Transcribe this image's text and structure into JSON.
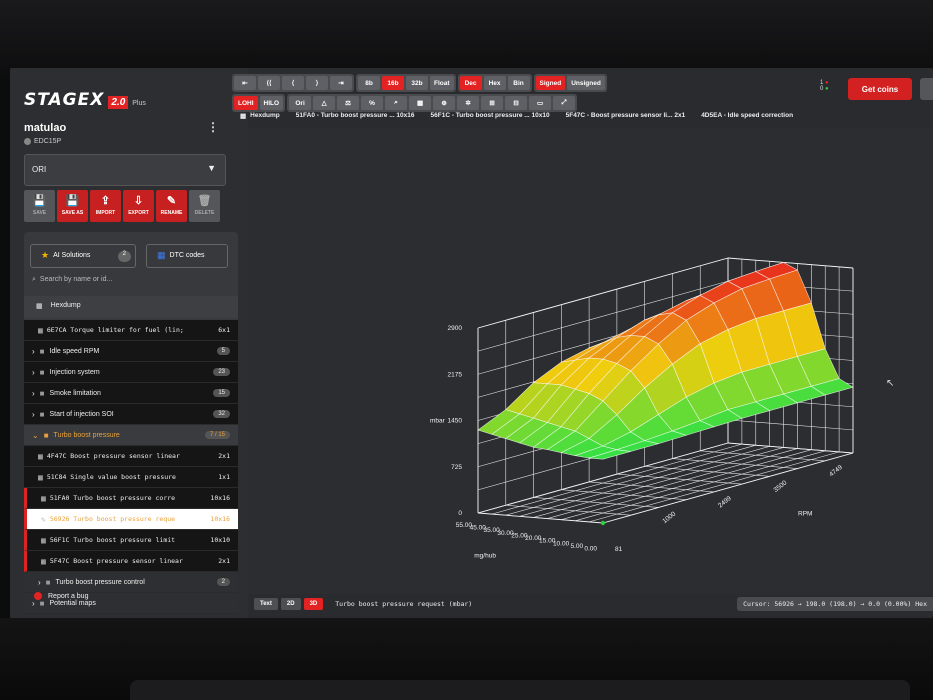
{
  "app": {
    "logo": "STAGEX",
    "version": "2.0",
    "edition": "Plus",
    "user": "matulao",
    "ecu": "EDC15P",
    "selected_file": "ORI"
  },
  "actions": [
    {
      "label": "SAVE",
      "icon": "💾",
      "enabled": false
    },
    {
      "label": "SAVE AS",
      "icon": "💾",
      "enabled": true
    },
    {
      "label": "IMPORT",
      "icon": "⇪",
      "enabled": true
    },
    {
      "label": "EXPORT",
      "icon": "⇩",
      "enabled": true
    },
    {
      "label": "RENAME",
      "icon": "✎",
      "enabled": true
    },
    {
      "label": "DELETE",
      "icon": "🗑",
      "enabled": false
    }
  ],
  "sidebar": {
    "ai_label": "AI Solutions",
    "ai_count": "2",
    "dtc_label": "DTC codes",
    "search_placeholder": "Search by name or id...",
    "hexdump_label": "Hexdump",
    "items": [
      {
        "kind": "map",
        "label": "6E7CA Torque limiter for fuel (lin;",
        "size": "6x1"
      },
      {
        "kind": "folder",
        "label": "Idle speed RPM",
        "count": "5"
      },
      {
        "kind": "folder",
        "label": "Injection system",
        "count": "23"
      },
      {
        "kind": "folder",
        "label": "Smoke limitation",
        "count": "15"
      },
      {
        "kind": "folder",
        "label": "Start of injection SOI",
        "count": "32"
      },
      {
        "kind": "folder-open",
        "label": "Turbo boost pressure",
        "count": "7 / 15"
      },
      {
        "kind": "map",
        "label": "4F47C Boost pressure sensor linear",
        "size": "2x1"
      },
      {
        "kind": "map",
        "label": "51C84 Single value boost pressure",
        "size": "1x1"
      },
      {
        "kind": "map",
        "label": "51FA0 Turbo boost pressure corre",
        "size": "10x16"
      },
      {
        "kind": "map-selected",
        "label": "56926 Turbo boost pressure reque",
        "size": "10x16"
      },
      {
        "kind": "map",
        "label": "56F1C Turbo boost pressure limit",
        "size": "10x10"
      },
      {
        "kind": "map",
        "label": "5F47C Boost pressure sensor linear",
        "size": "2x1"
      },
      {
        "kind": "subfolder",
        "label": "Turbo boost pressure control",
        "count": "2"
      },
      {
        "kind": "folder-plain",
        "label": "Potential maps",
        "count": ""
      }
    ],
    "report_label": "Report a bug"
  },
  "toolbar": {
    "row1_nav": [
      "⇤",
      "⟨⟨",
      "⟨",
      "⟩",
      "⇥"
    ],
    "row1_width": [
      {
        "label": "8b",
        "on": false
      },
      {
        "label": "16b",
        "on": true
      },
      {
        "label": "32b",
        "on": false
      },
      {
        "label": "Float",
        "on": false
      }
    ],
    "row1_base": [
      {
        "label": "Dec",
        "on": true
      },
      {
        "label": "Hex",
        "on": false
      },
      {
        "label": "Bin",
        "on": false
      }
    ],
    "row1_sign": [
      {
        "label": "Signed",
        "on": true
      },
      {
        "label": "Unsigned",
        "on": false
      }
    ],
    "row2_order": [
      {
        "label": "LOHI",
        "on": true
      },
      {
        "label": "HILO",
        "on": false
      }
    ],
    "row2_tools": [
      "Ori",
      "△",
      "⚖",
      "%",
      "⌕",
      "▦",
      "⊕",
      "✲",
      "⊞",
      "⊟",
      "▭",
      "⤢"
    ]
  },
  "tabs": [
    {
      "icon": "▦",
      "label": "Hexdump"
    },
    {
      "icon": "",
      "label": "51FA0 - Turbo boost pressure ... 10x16"
    },
    {
      "icon": "",
      "label": "56F1C - Turbo boost pressure ... 10x10"
    },
    {
      "icon": "",
      "label": "5F47C - Boost pressure sensor li... 2x1"
    },
    {
      "icon": "",
      "label": "4D5EA - Idle speed correction"
    }
  ],
  "header": {
    "status_1": "1",
    "status_0": "0",
    "coins_label": "Get coins"
  },
  "chart_data": {
    "type": "surface3d",
    "zlabel": "mbar",
    "xlabel": "mg/hub",
    "ylabel": "RPM",
    "z_ticks": [
      "2900",
      "2175",
      "1450",
      "725",
      "0"
    ],
    "x_ticks": [
      "55.00",
      "45.00",
      "35.00",
      "30.00",
      "25.00",
      "20.00",
      "15.00",
      "10.00",
      "5.00",
      "0.00"
    ],
    "y_ticks": [
      "1000",
      "2499",
      "3500",
      "4749"
    ],
    "y_origin_label": "81",
    "zlim": [
      0,
      2900
    ],
    "heights": [
      [
        1000,
        1000,
        1020,
        1050,
        1080,
        1100,
        1150,
        1200,
        1250,
        1300
      ],
      [
        1000,
        1010,
        1050,
        1150,
        1250,
        1300,
        1350,
        1400,
        1450,
        1500
      ],
      [
        1000,
        1030,
        1150,
        1400,
        1600,
        1700,
        1750,
        1800,
        1800,
        1800
      ],
      [
        1010,
        1060,
        1300,
        1700,
        1950,
        2050,
        2100,
        2100,
        2050,
        2000
      ],
      [
        1020,
        1100,
        1450,
        1950,
        2250,
        2350,
        2350,
        2300,
        2200,
        2100
      ],
      [
        1030,
        1150,
        1550,
        2150,
        2500,
        2600,
        2550,
        2450,
        2300,
        2150
      ],
      [
        1030,
        1150,
        1600,
        2250,
        2650,
        2750,
        2650,
        2500,
        2350,
        2200
      ],
      [
        1030,
        1150,
        1600,
        2300,
        2750,
        2850,
        2700,
        2550,
        2400,
        2250
      ],
      [
        1030,
        1150,
        1600,
        2300,
        2780,
        2880,
        2720,
        2570,
        2420,
        2270
      ],
      [
        1030,
        1150,
        1600,
        2300,
        2800,
        2900,
        2750,
        2600,
        2450,
        2300
      ]
    ]
  },
  "footer": {
    "views": [
      {
        "label": "Text",
        "on": false
      },
      {
        "label": "2D",
        "on": false
      },
      {
        "label": "3D",
        "on": true
      }
    ],
    "title": "Turbo boost pressure request (mbar)",
    "cursor": "Cursor: 56926 → 198.0 (198.0) → 0.0 (0.00%) Hex"
  },
  "colors": {
    "accent": "#e32323",
    "low": "#22e24a",
    "mid": "#f0d020",
    "high": "#e82a1e"
  }
}
